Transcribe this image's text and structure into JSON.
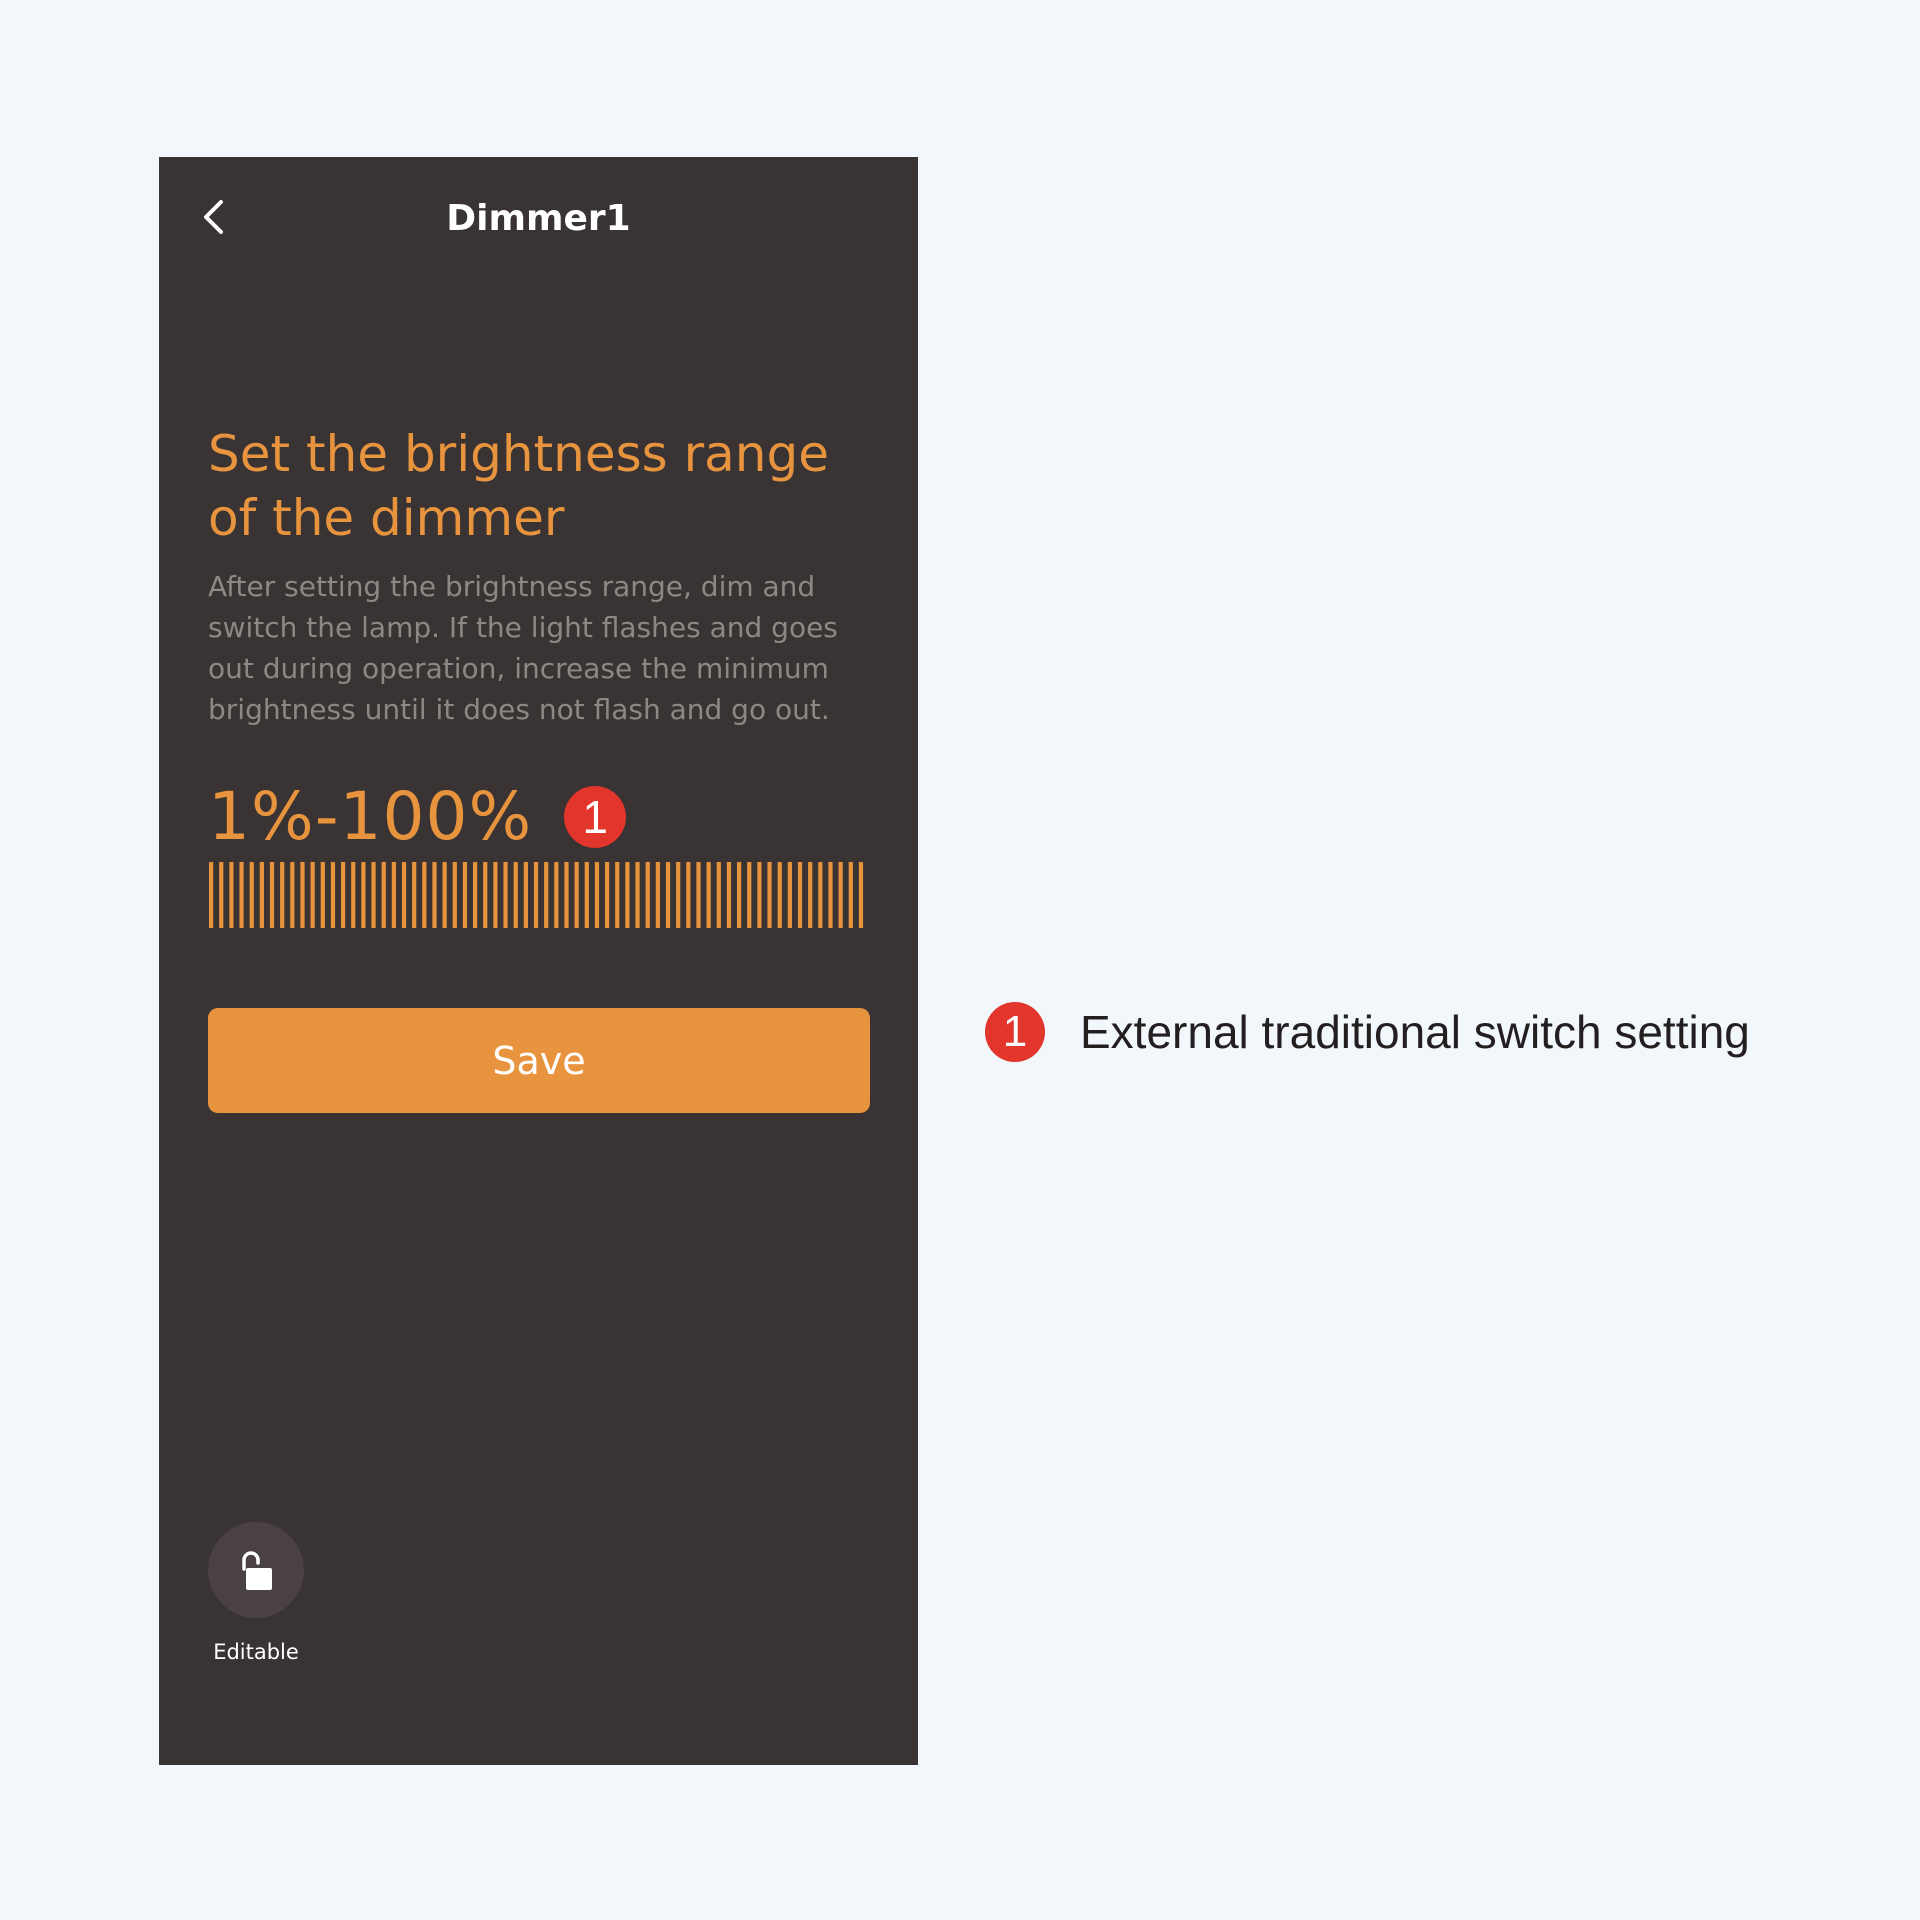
{
  "app": {
    "title": "Dimmer1",
    "back_icon": "chevron-left-icon"
  },
  "content": {
    "heading": "Set the brightness range of the dimmer",
    "description": "After setting the brightness range, dim and switch the lamp. If the light flashes and goes out during operation, increase the minimum brightness until it does not flash and go out.",
    "range_value": "1%-100%",
    "range_min_percent": 1,
    "range_max_percent": 100,
    "save_label": "Save"
  },
  "lock": {
    "icon": "unlock-icon",
    "label": "Editable"
  },
  "annotation": {
    "number": "1",
    "text": "External traditional switch setting"
  },
  "colors": {
    "accent": "#e8943f",
    "badge": "#e2352b",
    "phone_bg": "#393333",
    "page_bg": "#f2f7fb"
  }
}
